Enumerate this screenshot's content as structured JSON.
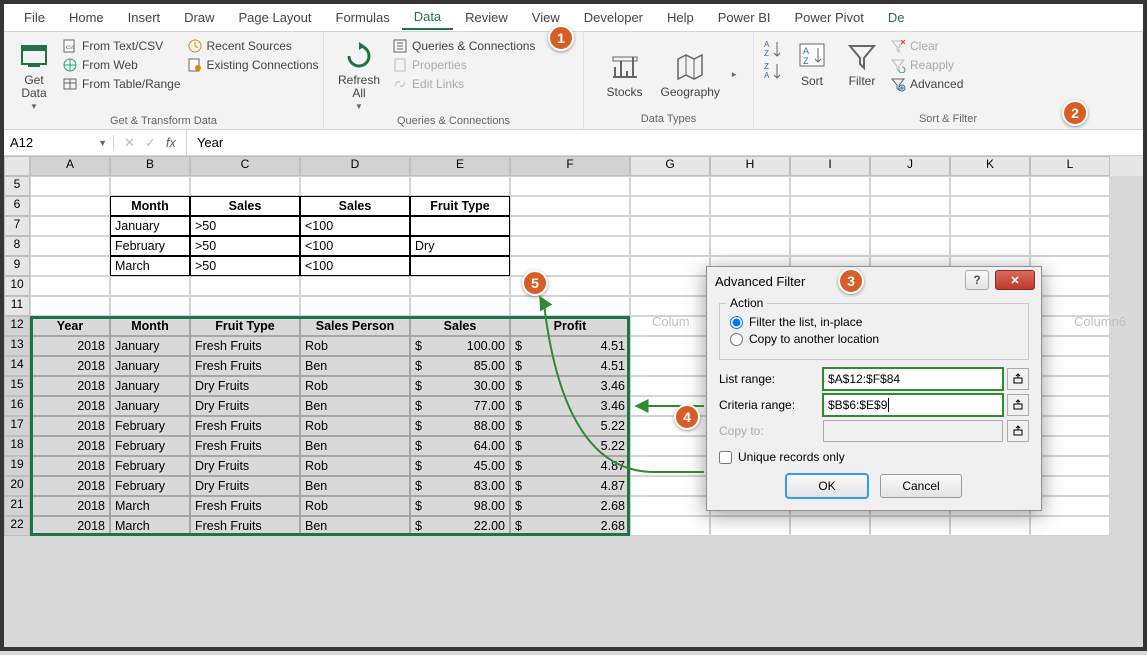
{
  "ribbon_tabs": [
    "File",
    "Home",
    "Insert",
    "Draw",
    "Page Layout",
    "Formulas",
    "Data",
    "Review",
    "View",
    "Developer",
    "Help",
    "Power BI",
    "Power Pivot"
  ],
  "active_tab_index": 6,
  "ribbon_tail": "De",
  "ribbon": {
    "get_data": "Get\nData",
    "from_textcsv": "From Text/CSV",
    "from_web": "From Web",
    "from_tablerange": "From Table/Range",
    "recent_sources": "Recent Sources",
    "existing_conn": "Existing Connections",
    "group_gettransform": "Get & Transform Data",
    "refresh_all": "Refresh\nAll",
    "queries_conn": "Queries & Connections",
    "properties": "Properties",
    "edit_links": "Edit Links",
    "group_queries": "Queries & Connections",
    "stocks": "Stocks",
    "geography": "Geography",
    "group_datatypes": "Data Types",
    "sort": "Sort",
    "filter": "Filter",
    "clear": "Clear",
    "reapply": "Reapply",
    "advanced": "Advanced",
    "group_sortfilter": "Sort & Filter"
  },
  "namebox": "A12",
  "formula": "Year",
  "columns": [
    "A",
    "B",
    "C",
    "D",
    "E",
    "F",
    "G",
    "H",
    "I",
    "J",
    "K",
    "L"
  ],
  "ghost_columns": {
    "left": "Colum",
    "right": "Column6"
  },
  "crit_rows_start": 5,
  "criteria": {
    "headers": [
      "Month",
      "Sales",
      "Sales",
      "Fruit Type"
    ],
    "rows": [
      [
        "January",
        ">50",
        "<100",
        ""
      ],
      [
        "February",
        ">50",
        "<100",
        "Dry"
      ],
      [
        "March",
        ">50",
        "<100",
        ""
      ]
    ]
  },
  "data_headers": [
    "Year",
    "Month",
    "Fruit Type",
    "Sales Person",
    "Sales",
    "Profit"
  ],
  "data_rows": [
    [
      "2018",
      "January",
      "Fresh Fruits",
      "Rob",
      "$",
      "100.00",
      "$",
      "4.51"
    ],
    [
      "2018",
      "January",
      "Fresh Fruits",
      "Ben",
      "$",
      "85.00",
      "$",
      "4.51"
    ],
    [
      "2018",
      "January",
      "Dry Fruits",
      "Rob",
      "$",
      "30.00",
      "$",
      "3.46"
    ],
    [
      "2018",
      "January",
      "Dry Fruits",
      "Ben",
      "$",
      "77.00",
      "$",
      "3.46"
    ],
    [
      "2018",
      "February",
      "Fresh Fruits",
      "Rob",
      "$",
      "88.00",
      "$",
      "5.22"
    ],
    [
      "2018",
      "February",
      "Fresh Fruits",
      "Ben",
      "$",
      "64.00",
      "$",
      "5.22"
    ],
    [
      "2018",
      "February",
      "Dry Fruits",
      "Rob",
      "$",
      "45.00",
      "$",
      "4.87"
    ],
    [
      "2018",
      "February",
      "Dry Fruits",
      "Ben",
      "$",
      "83.00",
      "$",
      "4.87"
    ],
    [
      "2018",
      "March",
      "Fresh Fruits",
      "Rob",
      "$",
      "98.00",
      "$",
      "2.68"
    ],
    [
      "2018",
      "March",
      "Fresh Fruits",
      "Ben",
      "$",
      "22.00",
      "$",
      "2.68"
    ]
  ],
  "row_numbers": [
    5,
    6,
    7,
    8,
    9,
    10,
    11,
    12,
    13,
    14,
    15,
    16,
    17,
    18,
    19,
    20,
    21,
    22
  ],
  "dialog": {
    "title": "Advanced Filter",
    "action": "Action",
    "radio1": "Filter the list, in-place",
    "radio2": "Copy to another location",
    "list_range_label": "List range:",
    "list_range": "$A$12:$F$84",
    "criteria_range_label": "Criteria range:",
    "criteria_range": "$B$6:$E$9",
    "copy_to_label": "Copy to:",
    "copy_to": "",
    "unique": "Unique records only",
    "ok": "OK",
    "cancel": "Cancel"
  },
  "callouts": {
    "c1": "1",
    "c2": "2",
    "c3": "3",
    "c4": "4",
    "c5": "5"
  },
  "chart_data": null
}
